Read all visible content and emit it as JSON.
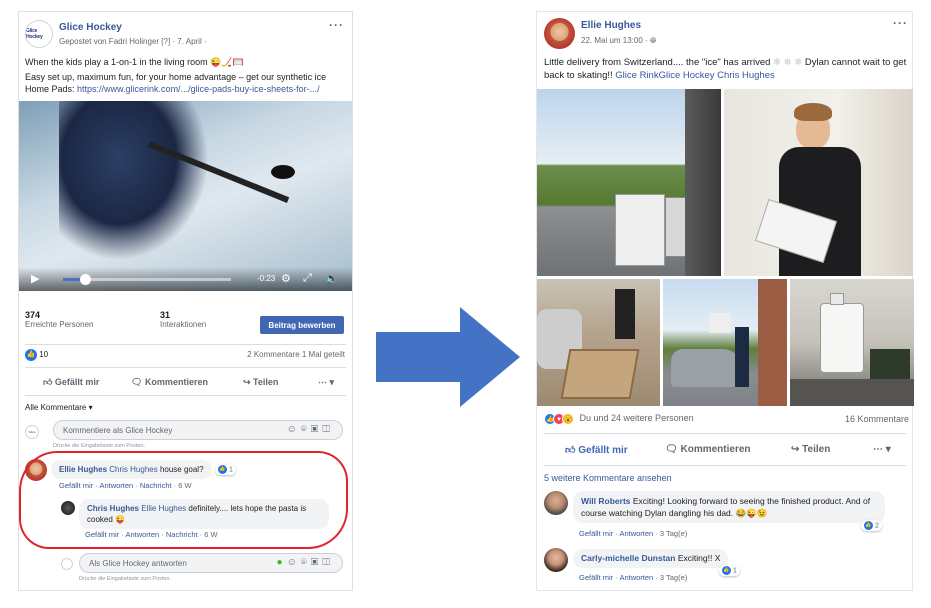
{
  "left_post": {
    "page_name": "Glice Hockey",
    "logo_text": "Glice Hockey",
    "meta": "Gepostet von Fadri Holinger [?] · 7. April ·",
    "more": "···",
    "text_line1": "When the kids play a 1-on-1 in the living room 😜🏒🥅",
    "text_line2": "Easy set up, maximum fun, for your home advantage – get our synthetic ice Home Pads: ",
    "link": "https://www.glicerink.com/.../glice-pads-buy-ice-sheets-for-.../",
    "video": {
      "time": "-0:23",
      "progress": 0.13
    },
    "stats": {
      "reached_value": "374",
      "reached_label": "Erreichte Personen",
      "interactions_value": "31",
      "interactions_label": "Interaktionen",
      "boost_button": "Beitrag bewerben"
    },
    "likes_count": "10",
    "comments_shares": "2 Kommentare  1 Mal geteilt",
    "actions": {
      "like": "Gefällt mir",
      "comment": "Kommentieren",
      "share": "Teilen"
    },
    "all_comments": "Alle Kommentare ▾",
    "comment_placeholder": "Kommentiere als Glice Hockey",
    "enter_hint": "Drücke die Eingabetaste zum Posten.",
    "comments": [
      {
        "author": "Ellie Hughes",
        "mention": "Chris Hughes",
        "text": " house goal?",
        "reactions": "1",
        "actions": [
          "Gefällt mir",
          "Antworten",
          "Nachricht",
          "6 W"
        ]
      },
      {
        "author": "Chris Hughes",
        "mention": "Ellie Hughes",
        "text": " definitely.... lets hope the pasta is cooked 😜",
        "actions": [
          "Gefällt mir",
          "Antworten",
          "Nachricht",
          "6 W"
        ]
      }
    ],
    "reply_placeholder": "Als Glice Hockey antworten"
  },
  "right_post": {
    "user": "Ellie Hughes",
    "when": "22. Mai um 13:00 ·",
    "more": "···",
    "text": "Little delivery from Switzerland.... the \"ice\" has arrived ",
    "text2": " Dylan cannot wait to get back to skating!! ",
    "tags": "Glice RinkGlice Hockey Chris Hughes",
    "reactions_text": "Du und 24 weitere Personen",
    "comments_count": "16 Kommentare",
    "actions": {
      "like": "Gefällt mir",
      "comment": "Kommentieren",
      "share": "Teilen"
    },
    "more_comments": "5 weitere Kommentare ansehen",
    "comments": [
      {
        "author": "Will Roberts",
        "text": " Exciting! Looking forward to seeing the finished product. And of course watching Dylan dangling his dad. 😂😜😉",
        "reactions": "2",
        "actions": [
          "Gefällt mir",
          "Antworten",
          "3 Tag(e)"
        ]
      },
      {
        "author": "Carly-michelle Dunstan",
        "text": " Exciting!! X",
        "reactions": "1",
        "actions": [
          "Gefällt mir",
          "Antworten",
          "3 Tag(e)"
        ]
      }
    ]
  },
  "colors": {
    "arrow": "#4472c4",
    "fb_blue": "#385898",
    "button_blue": "#4267b2",
    "circle_red": "#e0242c"
  }
}
